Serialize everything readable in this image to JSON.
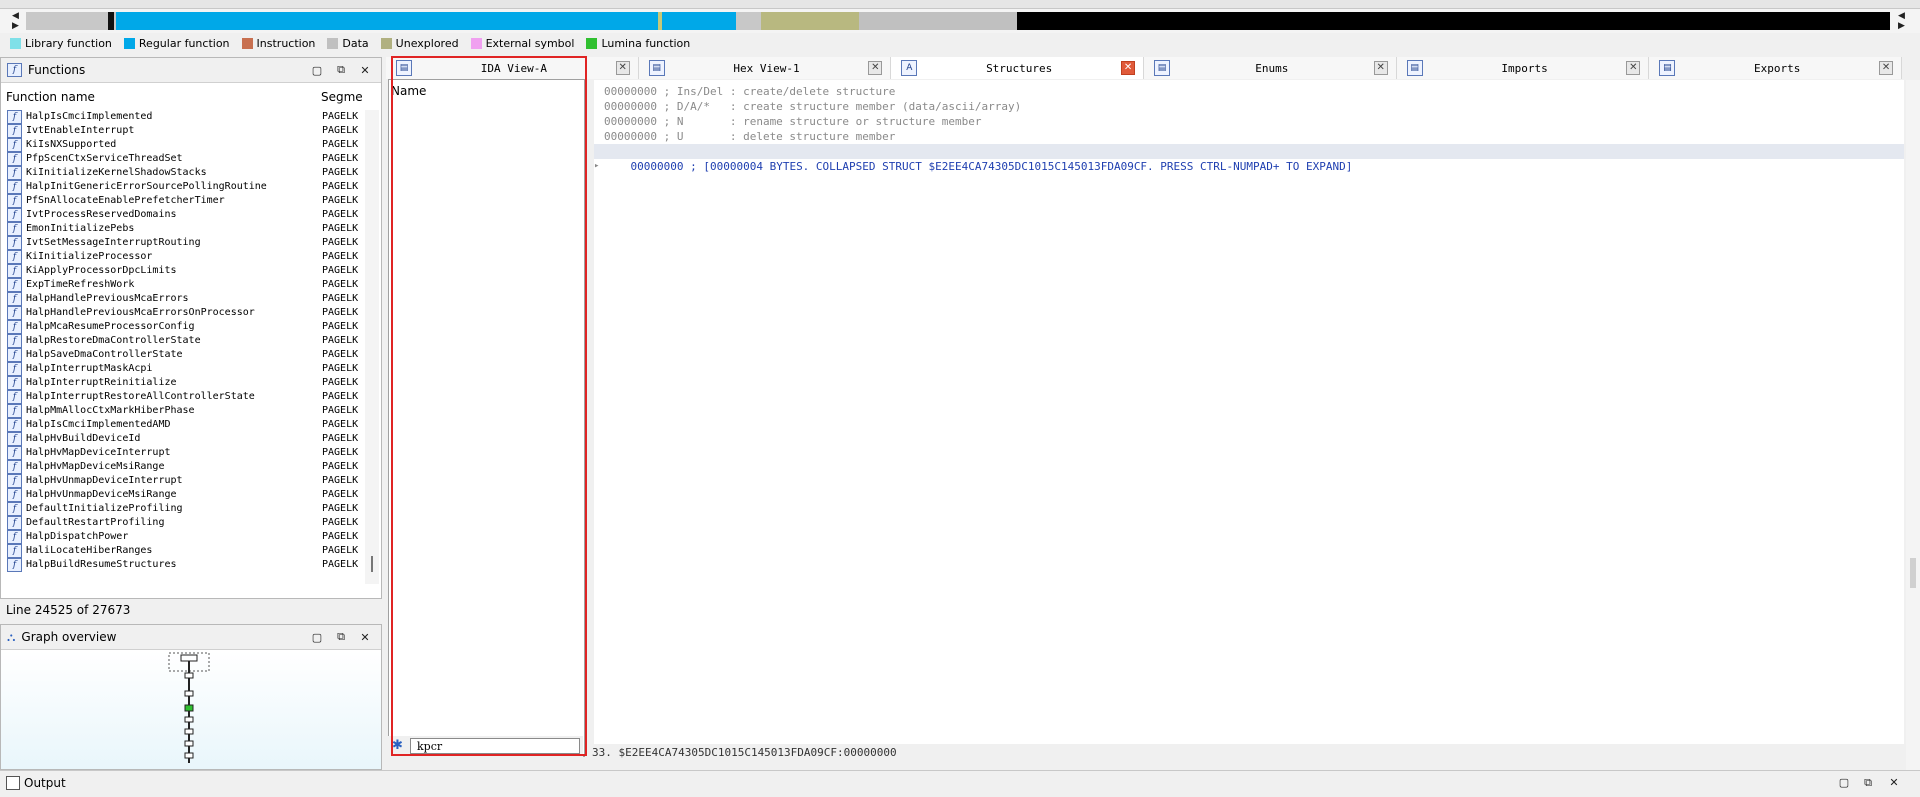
{
  "colors": {
    "library": "#7fe0e8",
    "regular": "#00a8e8",
    "instruction": "#c87050",
    "data": "#c0c0c0",
    "unexplored": "#b0b080",
    "external": "#f0a0f0",
    "lumina": "#30c030",
    "highlight": "#e02424"
  },
  "legend": [
    {
      "label": "Library function",
      "color": "#7fe0e8"
    },
    {
      "label": "Regular function",
      "color": "#00a8e8"
    },
    {
      "label": "Instruction",
      "color": "#c87050"
    },
    {
      "label": "Data",
      "color": "#c0c0c0"
    },
    {
      "label": "Unexplored",
      "color": "#b0b080"
    },
    {
      "label": "External symbol",
      "color": "#f0a0f0"
    },
    {
      "label": "Lumina function",
      "color": "#30c030"
    }
  ],
  "functions_panel": {
    "title": "Functions",
    "col_name": "Function name",
    "col_segment": "Segme",
    "items": [
      {
        "name": "HalpIsCmciImplemented",
        "seg": "PAGELK"
      },
      {
        "name": "IvtEnableInterrupt",
        "seg": "PAGELK"
      },
      {
        "name": "KiIsNXSupported",
        "seg": "PAGELK"
      },
      {
        "name": "PfpScenCtxServiceThreadSet",
        "seg": "PAGELK"
      },
      {
        "name": "KiInitializeKernelShadowStacks",
        "seg": "PAGELK"
      },
      {
        "name": "HalpInitGenericErrorSourcePollingRoutine",
        "seg": "PAGELK"
      },
      {
        "name": "PfSnAllocateEnablePrefetcherTimer",
        "seg": "PAGELK"
      },
      {
        "name": "IvtProcessReservedDomains",
        "seg": "PAGELK"
      },
      {
        "name": "EmonInitializePebs",
        "seg": "PAGELK"
      },
      {
        "name": "IvtSetMessageInterruptRouting",
        "seg": "PAGELK"
      },
      {
        "name": "KiInitializeProcessor",
        "seg": "PAGELK"
      },
      {
        "name": "KiApplyProcessorDpcLimits",
        "seg": "PAGELK"
      },
      {
        "name": "ExpTimeRefreshWork",
        "seg": "PAGELK"
      },
      {
        "name": "HalpHandlePreviousMcaErrors",
        "seg": "PAGELK"
      },
      {
        "name": "HalpHandlePreviousMcaErrorsOnProcessor",
        "seg": "PAGELK"
      },
      {
        "name": "HalpMcaResumeProcessorConfig",
        "seg": "PAGELK"
      },
      {
        "name": "HalpRestoreDmaControllerState",
        "seg": "PAGELK"
      },
      {
        "name": "HalpSaveDmaControllerState",
        "seg": "PAGELK"
      },
      {
        "name": "HalpInterruptMaskAcpi",
        "seg": "PAGELK"
      },
      {
        "name": "HalpInterruptReinitialize",
        "seg": "PAGELK"
      },
      {
        "name": "HalpInterruptRestoreAllControllerState",
        "seg": "PAGELK"
      },
      {
        "name": "HalpMmAllocCtxMarkHiberPhase",
        "seg": "PAGELK"
      },
      {
        "name": "HalpIsCmciImplementedAMD",
        "seg": "PAGELK"
      },
      {
        "name": "HalpHvBuildDeviceId",
        "seg": "PAGELK"
      },
      {
        "name": "HalpHvMapDeviceInterrupt",
        "seg": "PAGELK"
      },
      {
        "name": "HalpHvMapDeviceMsiRange",
        "seg": "PAGELK"
      },
      {
        "name": "HalpHvUnmapDeviceInterrupt",
        "seg": "PAGELK"
      },
      {
        "name": "HalpHvUnmapDeviceMsiRange",
        "seg": "PAGELK"
      },
      {
        "name": "DefaultInitializeProfiling",
        "seg": "PAGELK"
      },
      {
        "name": "DefaultRestartProfiling",
        "seg": "PAGELK"
      },
      {
        "name": "HalpDispatchPower",
        "seg": "PAGELK"
      },
      {
        "name": "HaliLocateHiberRanges",
        "seg": "PAGELK"
      },
      {
        "name": "HalpBuildResumeStructures",
        "seg": "PAGELK"
      }
    ]
  },
  "line_info": "Line 24525 of 27673",
  "graph_panel": {
    "title": "Graph overview"
  },
  "output_panel": {
    "title": "Output"
  },
  "tabs": [
    {
      "label": "IDA View-A",
      "icon": "ida-view-icon"
    },
    {
      "label": "Hex View-1",
      "icon": "hex-view-icon"
    },
    {
      "label": "Structures",
      "icon": "structures-icon"
    },
    {
      "label": "Enums",
      "icon": "enums-icon"
    },
    {
      "label": "Imports",
      "icon": "imports-icon"
    },
    {
      "label": "Exports",
      "icon": "exports-icon"
    }
  ],
  "structures": {
    "col_name": "Name",
    "search_value": "kpcr",
    "lines": [
      "00000000 ; Ins/Del : create/delete structure",
      "00000000 ; D/A/*   : create structure member (data/ascii/array)",
      "00000000 ; N       : rename structure or structure member",
      "00000000 ; U       : delete structure member"
    ],
    "selected_line": "00000000 ; [00000004 BYTES. COLLAPSED STRUCT $E2EE4CA74305DC1015C145013FDA09CF. PRESS CTRL-NUMPAD+ TO EXPAND]",
    "status": "33. $E2EE4CA74305DC1015C145013FDA09CF:00000000"
  }
}
